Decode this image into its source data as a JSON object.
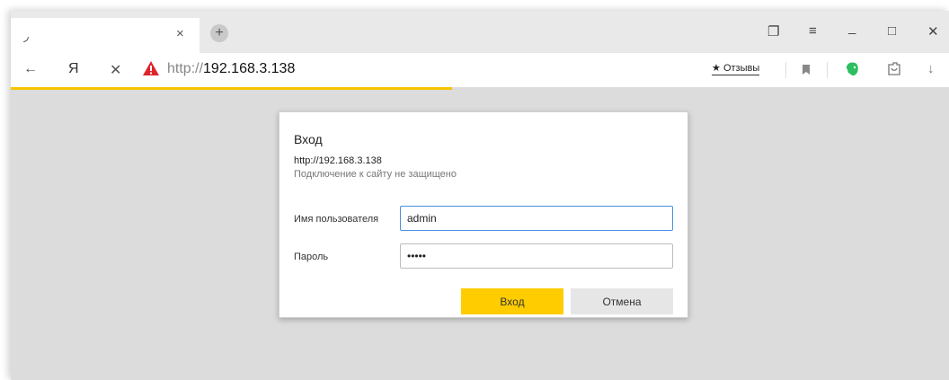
{
  "browser": {
    "tab": {
      "favicon": "loading-icon",
      "close": "×"
    },
    "new_tab": "+",
    "window_controls": {
      "collections": "❐",
      "menu": "≡",
      "minimize": "_",
      "maximize": "□",
      "close": "✕"
    },
    "nav": {
      "back": "←",
      "ya": "Я",
      "stop": "✕"
    },
    "address": {
      "scheme": "http://",
      "host": "192.168.3.138"
    },
    "bookmarks": {
      "reviews_star": "★",
      "reviews_label": "Отзывы"
    },
    "right_icons": {
      "bookmark": "bookmark-icon",
      "evernote": "evernote-icon",
      "extension": "extension-icon",
      "download": "↓"
    },
    "load_progress": 0.47
  },
  "dialog": {
    "title": "Вход",
    "url": "http://192.168.3.138",
    "note": "Подключение к сайту не защищено",
    "username_label": "Имя пользователя",
    "username_value": "admin",
    "password_label": "Пароль",
    "password_value": "admin",
    "login_button": "Вход",
    "cancel_button": "Отмена"
  },
  "colors": {
    "accent": "#ffcc00",
    "progress": "#f5c400",
    "warning": "#e0242b",
    "evernote": "#2dbe60"
  }
}
